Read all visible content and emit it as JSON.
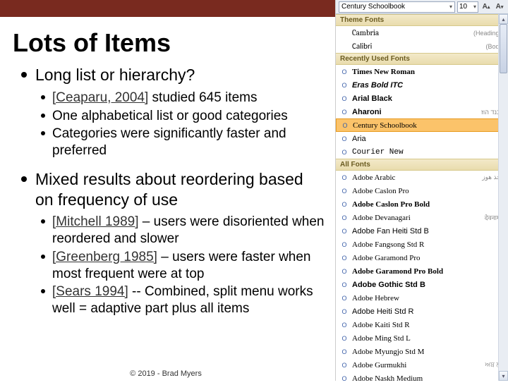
{
  "slide": {
    "title": "Lots of Items",
    "footer": "© 2019 - Brad Myers",
    "bullets": [
      {
        "text": "Long list or hierarchy?",
        "children": [
          {
            "cite": "[Ceaparu, 2004]",
            "rest": " studied 645 items"
          },
          {
            "cite": "",
            "rest": "One alphabetical list or good categories"
          },
          {
            "cite": "",
            "rest": "Categories were significantly faster and preferred"
          }
        ]
      },
      {
        "text": "Mixed results about reordering based on frequency of use",
        "children": [
          {
            "cite": "[Mitchell 1989]",
            "rest": " – users were disoriented when reordered and slower"
          },
          {
            "cite": "[Greenberg 1985]",
            "rest": " – users were faster when most frequent were at top"
          },
          {
            "cite": "[Sears 1994]",
            "rest": " -- Combined, split menu works well = adaptive part plus all items"
          }
        ]
      }
    ]
  },
  "fontpanel": {
    "toolbar": {
      "font": "Century Schoolbook",
      "size": "10",
      "btnGrow": "A^",
      "btnShrink": "A˅"
    },
    "sections": {
      "theme": {
        "label": "Theme Fonts",
        "items": [
          {
            "icon": "",
            "name": "Cambria",
            "meta": "(Headings)",
            "css": "font-family: Cambria, Georgia, serif;"
          },
          {
            "icon": "",
            "name": "Calibri",
            "meta": "(Body)",
            "css": "font-family: Calibri, Arial, sans-serif;"
          }
        ]
      },
      "recent": {
        "label": "Recently Used Fonts",
        "items": [
          {
            "icon": "O",
            "name": "Times New Roman",
            "meta": "",
            "css": "font-family: 'Times New Roman', serif; font-weight:bold;"
          },
          {
            "icon": "O",
            "name": "Eras Bold ITC",
            "meta": "",
            "css": "font-family: Arial, sans-serif; font-weight:bold; font-style:italic;"
          },
          {
            "icon": "O",
            "name": "Arial Black",
            "meta": "",
            "css": "font-family: 'Arial Black', Arial, sans-serif; font-weight:900;"
          },
          {
            "icon": "O",
            "name": "Aharoni",
            "meta": "אבנד הוז",
            "css": "font-family: Arial, sans-serif; font-weight:bold;"
          },
          {
            "icon": "O",
            "name": "Century Schoolbook",
            "meta": "",
            "css": "font-family: 'Century Schoolbook', Georgia, serif;",
            "highlight": true
          },
          {
            "icon": "O",
            "name": "Aria",
            "meta": "",
            "css": "font-family: Arial, sans-serif;"
          },
          {
            "icon": "O",
            "name": "Courier New",
            "meta": "",
            "css": "font-family: 'Courier New', monospace;"
          }
        ]
      },
      "all": {
        "label": "All Fonts",
        "items": [
          {
            "icon": "O",
            "name": "Adobe Arabic",
            "meta": "أيجذ هوز",
            "css": "font-family: Georgia, serif;"
          },
          {
            "icon": "O",
            "name": "Adobe Caslon Pro",
            "meta": "",
            "css": "font-family: Georgia, serif;"
          },
          {
            "icon": "O",
            "name": "Adobe Caslon Pro Bold",
            "meta": "",
            "css": "font-family: Georgia, serif; font-weight:bold;"
          },
          {
            "icon": "O",
            "name": "Adobe Devanagari",
            "meta": "देवनागरी",
            "css": "font-family: Georgia, serif;"
          },
          {
            "icon": "O",
            "name": "Adobe Fan Heiti Std B",
            "meta": "",
            "css": "font-family: Arial, sans-serif;"
          },
          {
            "icon": "O",
            "name": "Adobe Fangsong Std R",
            "meta": "",
            "css": "font-family: Georgia, serif;"
          },
          {
            "icon": "O",
            "name": "Adobe Garamond Pro",
            "meta": "",
            "css": "font-family: Garamond, Georgia, serif;"
          },
          {
            "icon": "O",
            "name": "Adobe Garamond Pro Bold",
            "meta": "",
            "css": "font-family: Garamond, Georgia, serif; font-weight:bold;"
          },
          {
            "icon": "O",
            "name": "Adobe Gothic Std B",
            "meta": "",
            "css": "font-family: Arial, sans-serif; font-weight:bold;"
          },
          {
            "icon": "O",
            "name": "Adobe Hebrew",
            "meta": "",
            "css": "font-family: Georgia, serif;"
          },
          {
            "icon": "O",
            "name": "Adobe Heiti Std R",
            "meta": "",
            "css": "font-family: Arial, sans-serif;"
          },
          {
            "icon": "O",
            "name": "Adobe Kaiti Std R",
            "meta": "",
            "css": "font-family: Georgia, serif;"
          },
          {
            "icon": "O",
            "name": "Adobe Ming Std L",
            "meta": "",
            "css": "font-family: Georgia, serif;"
          },
          {
            "icon": "O",
            "name": "Adobe Myungjo Std M",
            "meta": "",
            "css": "font-family: Georgia, serif;"
          },
          {
            "icon": "O",
            "name": "Adobe Gurmukhi",
            "meta": "ਅਬ ਲਹ",
            "css": "font-family: Georgia, serif;"
          },
          {
            "icon": "O",
            "name": "Adobe Naskh Medium",
            "meta": "",
            "css": "font-family: Georgia, serif;"
          }
        ]
      }
    }
  }
}
